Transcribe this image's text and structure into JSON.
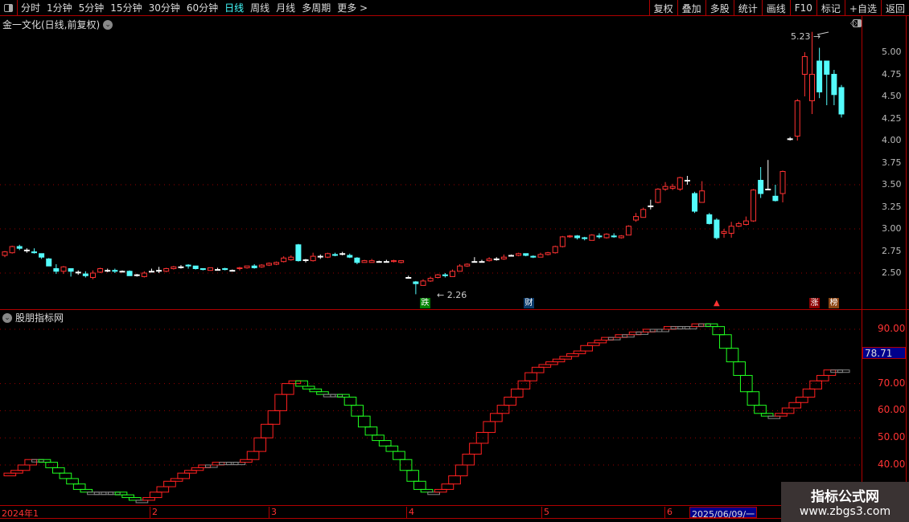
{
  "toolbar": {
    "periods": [
      "分时",
      "1分钟",
      "5分钟",
      "15分钟",
      "30分钟",
      "60分钟",
      "日线",
      "周线",
      "月线",
      "多周期",
      "更多 >"
    ],
    "active": "日线",
    "right": [
      "复权",
      "叠加",
      "多股",
      "统计",
      "画线",
      "F10",
      "标记",
      "+自选",
      "返回"
    ]
  },
  "stock_title": "金一文化(日线,前复权)",
  "indicator_title": "股朋指标网",
  "colors": {
    "up": "#ff3232",
    "down": "#54fcfc",
    "flat": "#ffffff",
    "ind_up": "#ff2020",
    "ind_down": "#20ff20",
    "ind_flat": "#888888"
  },
  "price_axis": [
    "5.00",
    "4.75",
    "4.50",
    "4.25",
    "4.00",
    "3.75",
    "3.50",
    "3.25",
    "3.00",
    "2.75",
    "2.50"
  ],
  "indicator_axis": [
    "90.00",
    "70.00",
    "60.00",
    "50.00",
    "40.00"
  ],
  "indicator_current": "78.71",
  "annotations": {
    "high": "5.23",
    "low": "2.26"
  },
  "badges": [
    {
      "label": "跌",
      "color": "#008000"
    },
    {
      "label": "财",
      "color": "#0a3a6a"
    },
    {
      "label": "涨",
      "color": "#8b0000"
    },
    {
      "label": "榜",
      "color": "#8b4513"
    }
  ],
  "time_axis": {
    "ticks": [
      "2024年1",
      "2",
      "3",
      "4",
      "5",
      "6"
    ],
    "cursor_date": "2025/06/09/一"
  },
  "watermark": {
    "title": "指标公式网",
    "url": "www.zbgs3.com"
  },
  "candles": [
    [
      2.7,
      2.74,
      2.75,
      2.68
    ],
    [
      2.73,
      2.8,
      2.81,
      2.72
    ],
    [
      2.8,
      2.78,
      2.82,
      2.76
    ],
    [
      2.76,
      2.76,
      2.78,
      2.73
    ],
    [
      2.74,
      2.73,
      2.78,
      2.72
    ],
    [
      2.72,
      2.68,
      2.7,
      2.66
    ],
    [
      2.66,
      2.58,
      2.67,
      2.58
    ],
    [
      2.55,
      2.52,
      2.6,
      2.49
    ],
    [
      2.52,
      2.57,
      2.58,
      2.49
    ],
    [
      2.55,
      2.52,
      2.55,
      2.46
    ],
    [
      2.51,
      2.51,
      2.53,
      2.48
    ],
    [
      2.49,
      2.47,
      2.52,
      2.45
    ],
    [
      2.45,
      2.5,
      2.53,
      2.43
    ],
    [
      2.51,
      2.55,
      2.56,
      2.5
    ],
    [
      2.53,
      2.53,
      2.55,
      2.51
    ],
    [
      2.53,
      2.52,
      2.55,
      2.5
    ],
    [
      2.52,
      2.52,
      2.53,
      2.51
    ],
    [
      2.52,
      2.47,
      2.53,
      2.47
    ],
    [
      2.48,
      2.48,
      2.49,
      2.46
    ],
    [
      2.46,
      2.5,
      2.52,
      2.45
    ],
    [
      2.52,
      2.52,
      2.55,
      2.51
    ],
    [
      2.53,
      2.53,
      2.57,
      2.5
    ],
    [
      2.52,
      2.55,
      2.56,
      2.51
    ],
    [
      2.55,
      2.57,
      2.58,
      2.54
    ],
    [
      2.57,
      2.57,
      2.59,
      2.55
    ],
    [
      2.59,
      2.58,
      2.6,
      2.55
    ],
    [
      2.58,
      2.55,
      2.58,
      2.54
    ],
    [
      2.55,
      2.54,
      2.55,
      2.53
    ],
    [
      2.53,
      2.56,
      2.56,
      2.53
    ],
    [
      2.54,
      2.54,
      2.56,
      2.53
    ],
    [
      2.55,
      2.54,
      2.56,
      2.53
    ],
    [
      2.53,
      2.53,
      2.54,
      2.52
    ],
    [
      2.55,
      2.56,
      2.57,
      2.53
    ],
    [
      2.56,
      2.58,
      2.58,
      2.55
    ],
    [
      2.58,
      2.56,
      2.6,
      2.55
    ],
    [
      2.57,
      2.59,
      2.6,
      2.56
    ],
    [
      2.59,
      2.61,
      2.62,
      2.58
    ],
    [
      2.6,
      2.62,
      2.63,
      2.59
    ],
    [
      2.63,
      2.67,
      2.69,
      2.62
    ],
    [
      2.65,
      2.68,
      2.7,
      2.64
    ],
    [
      2.82,
      2.64,
      2.83,
      2.63
    ],
    [
      2.65,
      2.65,
      2.66,
      2.62
    ],
    [
      2.64,
      2.69,
      2.73,
      2.63
    ],
    [
      2.69,
      2.69,
      2.71,
      2.66
    ],
    [
      2.68,
      2.72,
      2.73,
      2.67
    ],
    [
      2.71,
      2.7,
      2.73,
      2.69
    ],
    [
      2.72,
      2.72,
      2.74,
      2.7
    ],
    [
      2.7,
      2.68,
      2.72,
      2.67
    ],
    [
      2.67,
      2.62,
      2.68,
      2.6
    ],
    [
      2.62,
      2.64,
      2.65,
      2.62
    ],
    [
      2.62,
      2.64,
      2.66,
      2.62
    ],
    [
      2.63,
      2.63,
      2.64,
      2.62
    ],
    [
      2.63,
      2.63,
      2.65,
      2.62
    ],
    [
      2.63,
      2.64,
      2.65,
      2.62
    ],
    [
      2.62,
      2.64,
      2.64,
      2.61
    ],
    [
      2.45,
      2.45,
      2.47,
      2.45
    ],
    [
      2.4,
      2.38,
      2.41,
      2.26
    ],
    [
      2.36,
      2.41,
      2.43,
      2.36
    ],
    [
      2.41,
      2.44,
      2.46,
      2.4
    ],
    [
      2.45,
      2.48,
      2.49,
      2.44
    ],
    [
      2.48,
      2.47,
      2.5,
      2.45
    ],
    [
      2.46,
      2.52,
      2.54,
      2.46
    ],
    [
      2.52,
      2.58,
      2.6,
      2.52
    ],
    [
      2.58,
      2.6,
      2.61,
      2.57
    ],
    [
      2.63,
      2.63,
      2.68,
      2.62
    ],
    [
      2.63,
      2.63,
      2.65,
      2.62
    ],
    [
      2.64,
      2.66,
      2.68,
      2.63
    ],
    [
      2.66,
      2.66,
      2.68,
      2.64
    ],
    [
      2.66,
      2.68,
      2.71,
      2.65
    ],
    [
      2.7,
      2.7,
      2.71,
      2.69
    ],
    [
      2.7,
      2.72,
      2.73,
      2.69
    ],
    [
      2.72,
      2.7,
      2.72,
      2.69
    ],
    [
      2.69,
      2.68,
      2.7,
      2.67
    ],
    [
      2.68,
      2.71,
      2.73,
      2.68
    ],
    [
      2.71,
      2.73,
      2.74,
      2.7
    ],
    [
      2.73,
      2.8,
      2.81,
      2.72
    ],
    [
      2.8,
      2.91,
      2.92,
      2.79
    ],
    [
      2.91,
      2.92,
      2.93,
      2.9
    ],
    [
      2.92,
      2.9,
      2.93,
      2.88
    ],
    [
      2.9,
      2.89,
      2.91,
      2.87
    ],
    [
      2.87,
      2.93,
      2.94,
      2.87
    ],
    [
      2.92,
      2.91,
      2.95,
      2.89
    ],
    [
      2.9,
      2.94,
      2.95,
      2.89
    ],
    [
      2.92,
      2.91,
      2.95,
      2.9
    ],
    [
      2.9,
      2.92,
      2.93,
      2.89
    ],
    [
      2.93,
      3.03,
      3.04,
      2.93
    ],
    [
      3.1,
      3.14,
      3.18,
      3.08
    ],
    [
      3.13,
      3.22,
      3.24,
      3.13
    ],
    [
      3.26,
      3.26,
      3.33,
      3.22
    ],
    [
      3.3,
      3.45,
      3.46,
      3.29
    ],
    [
      3.45,
      3.48,
      3.53,
      3.43
    ],
    [
      3.46,
      3.48,
      3.51,
      3.44
    ],
    [
      3.45,
      3.58,
      3.59,
      3.43
    ],
    [
      3.55,
      3.55,
      3.6,
      3.5
    ],
    [
      3.4,
      3.2,
      3.42,
      3.18
    ],
    [
      3.3,
      3.43,
      3.54,
      3.3
    ],
    [
      3.16,
      3.06,
      3.18,
      3.05
    ],
    [
      3.1,
      2.9,
      3.12,
      2.88
    ],
    [
      2.95,
      2.97,
      3.0,
      2.9
    ],
    [
      2.95,
      3.03,
      3.08,
      2.9
    ],
    [
      3.03,
      3.06,
      3.08,
      3.02
    ],
    [
      3.05,
      3.09,
      3.14,
      3.04
    ],
    [
      3.09,
      3.44,
      3.45,
      3.08
    ],
    [
      3.55,
      3.4,
      3.7,
      3.35
    ],
    [
      3.45,
      3.45,
      3.78,
      3.44
    ],
    [
      3.37,
      3.32,
      3.5,
      3.31
    ],
    [
      3.4,
      3.65,
      3.66,
      3.3
    ],
    [
      4.02,
      4.02,
      4.04,
      4.0
    ],
    [
      4.05,
      4.45,
      4.47,
      4.0
    ],
    [
      4.75,
      4.95,
      5.0,
      4.5
    ],
    [
      4.45,
      4.75,
      5.23,
      4.3
    ],
    [
      4.9,
      4.55,
      5.05,
      4.48
    ],
    [
      4.9,
      4.75,
      4.9,
      4.4
    ],
    [
      4.75,
      4.52,
      4.8,
      4.4
    ],
    [
      4.6,
      4.3,
      4.63,
      4.26
    ]
  ],
  "indicator": [
    36,
    37,
    38,
    40,
    42,
    42,
    41,
    39,
    37,
    35,
    33,
    31,
    30,
    30,
    30,
    30,
    30,
    29,
    28,
    27,
    27,
    28,
    30,
    32,
    34,
    35,
    37,
    38,
    39,
    40,
    40,
    41,
    41,
    41,
    41,
    42,
    45,
    50,
    55,
    60,
    66,
    70,
    71,
    69,
    68,
    67,
    66,
    66,
    66,
    65,
    62,
    58,
    54,
    51,
    49,
    47,
    45,
    42,
    38,
    34,
    31,
    30,
    30,
    31,
    33,
    36,
    40,
    44,
    48,
    52,
    56,
    59,
    62,
    65,
    68,
    71,
    74,
    76,
    77,
    78,
    79,
    80,
    81,
    82,
    84,
    85,
    86,
    87,
    87,
    88,
    88,
    89,
    89,
    90,
    90,
    90,
    91,
    91,
    91,
    91,
    92,
    92,
    91,
    88,
    83,
    78,
    73,
    67,
    62,
    59,
    58,
    58,
    59,
    61,
    63,
    65,
    68,
    71,
    73,
    75,
    75,
    75
  ]
}
